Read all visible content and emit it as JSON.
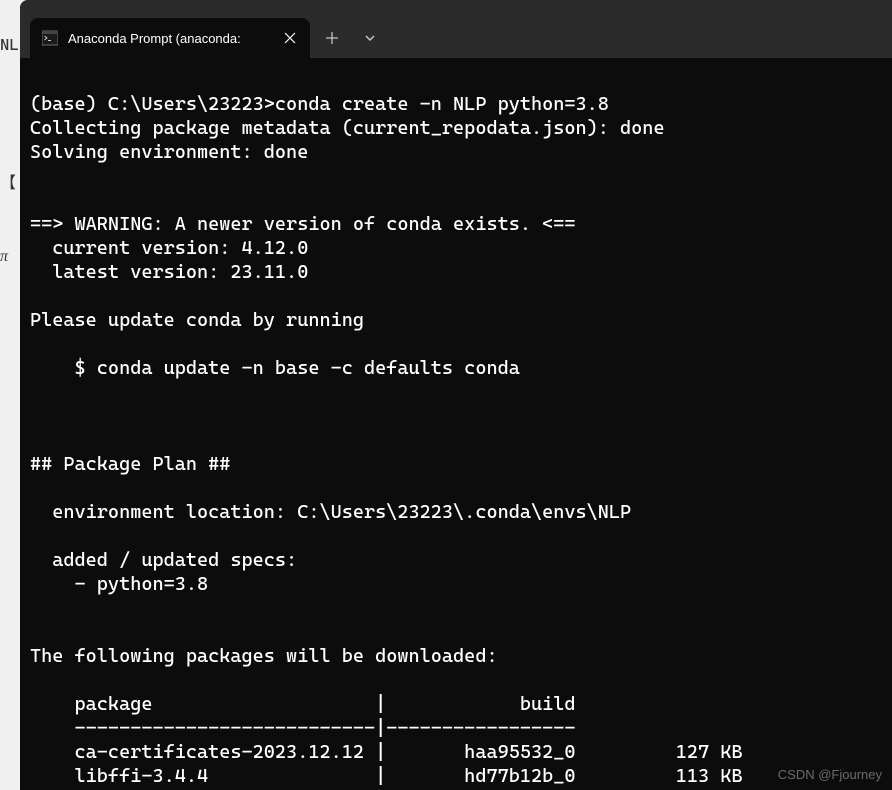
{
  "bg": {
    "t1": "NL",
    "t2": "【",
    "t3": "π"
  },
  "tab": {
    "title": "Anaconda Prompt (anaconda:"
  },
  "terminal": {
    "content": "\n(base) C:\\Users\\23223>conda create -n NLP python=3.8\nCollecting package metadata (current_repodata.json): done\nSolving environment: done\n\n\n==> WARNING: A newer version of conda exists. <==\n  current version: 4.12.0\n  latest version: 23.11.0\n\nPlease update conda by running\n\n    $ conda update -n base -c defaults conda\n\n\n\n## Package Plan ##\n\n  environment location: C:\\Users\\23223\\.conda\\envs\\NLP\n\n  added / updated specs:\n    - python=3.8\n\n\nThe following packages will be downloaded:\n\n    package                    |            build\n    ---------------------------|-----------------\n    ca-certificates-2023.12.12 |       haa95532_0         127 KB\n    libffi-3.4.4               |       hd77b12b_0         113 KB"
  },
  "watermark": "CSDN @Fjourney"
}
